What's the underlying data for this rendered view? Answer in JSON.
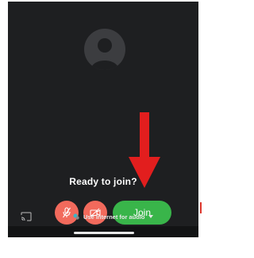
{
  "preview": {
    "status_text": "Ready to join?"
  },
  "controls": {
    "mic_icon": "mic-off-icon",
    "camera_icon": "camera-off-icon",
    "join_label": "Join",
    "join_color": "#39b54a",
    "muted_color": "#f26a5c"
  },
  "bottom_bar": {
    "cast_icon": "cast-icon",
    "audio_label": "Use Internet for audio"
  },
  "annotation": {
    "arrow_color": "#e21e1e"
  },
  "colors": {
    "background": "#1e1f21"
  }
}
